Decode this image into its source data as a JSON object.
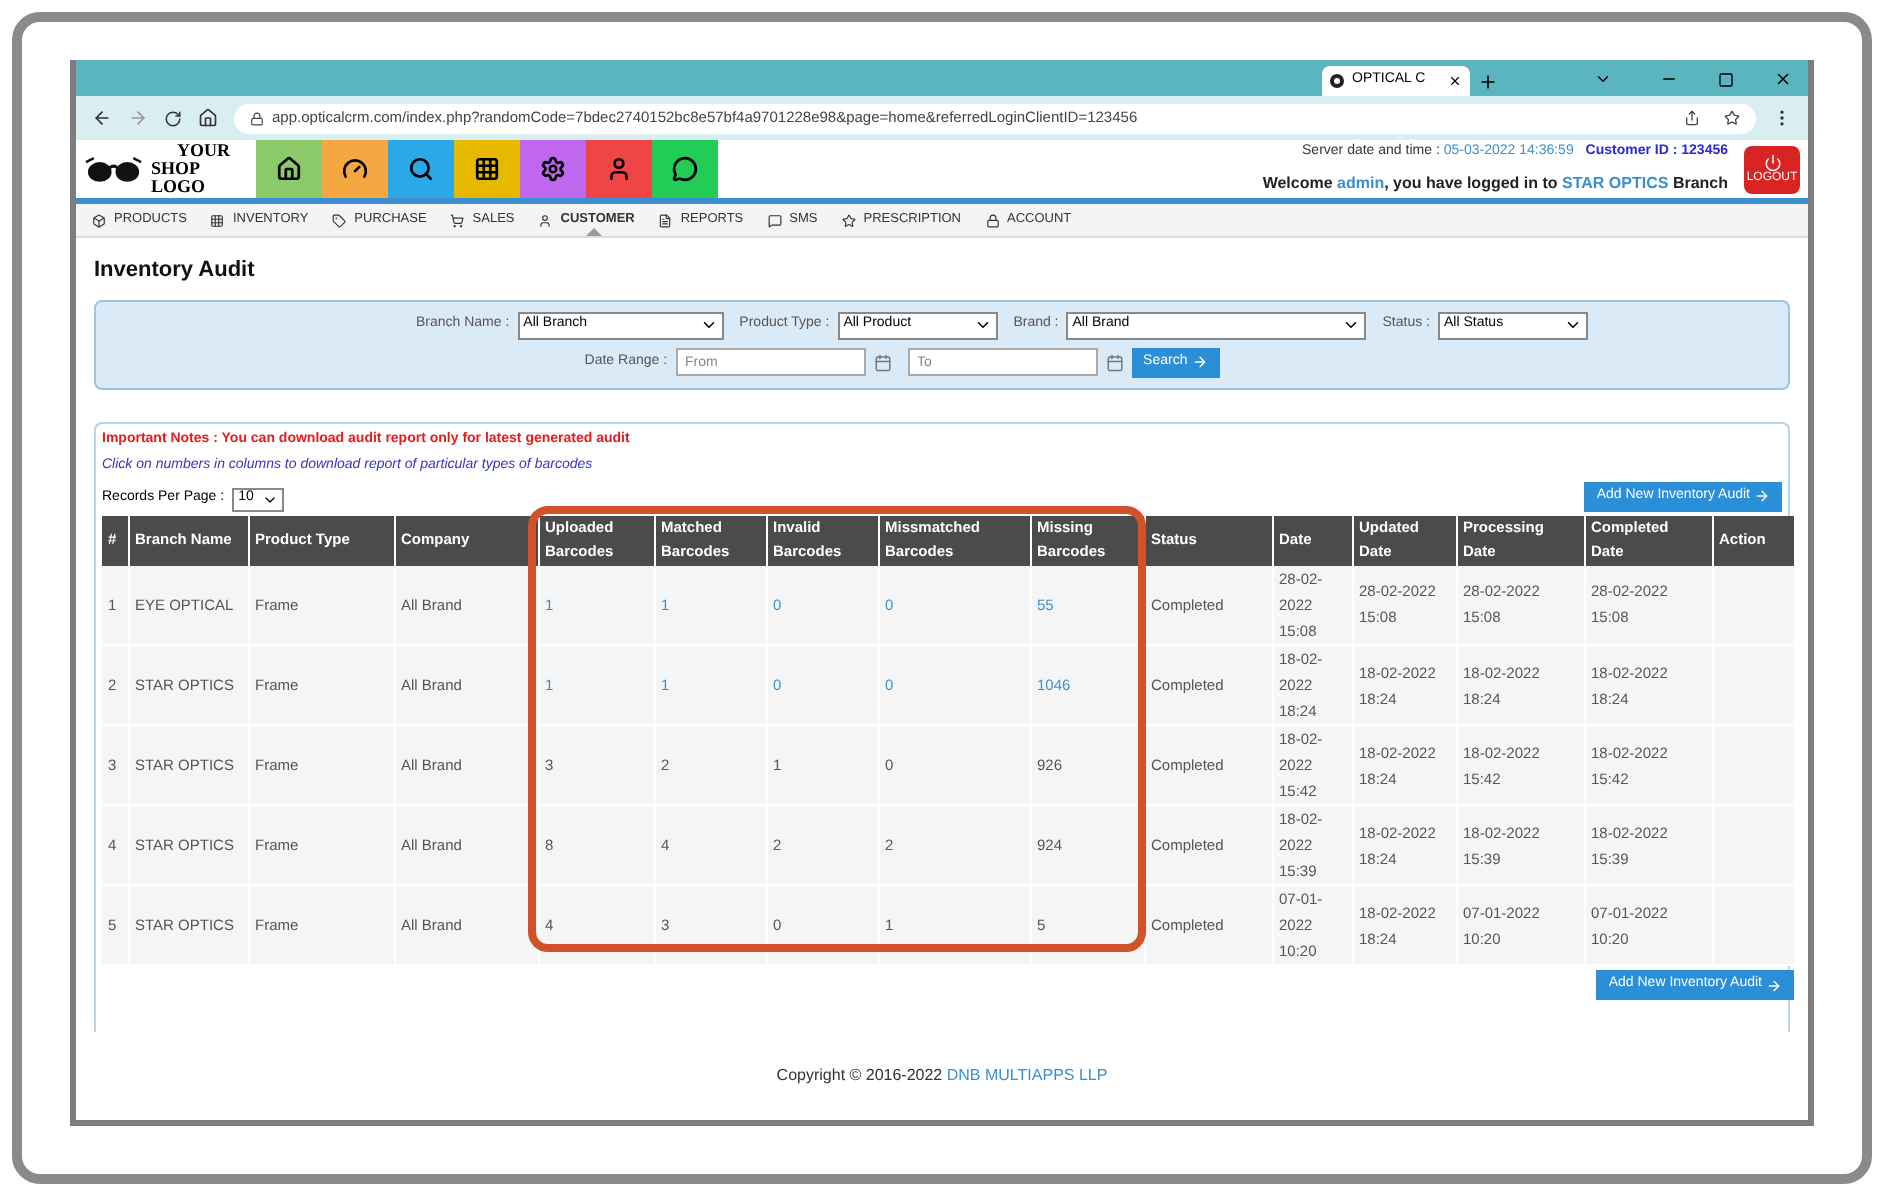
{
  "browser": {
    "tab_title": "OPTICAL C",
    "url": "app.opticalcrm.com/index.php?randomCode=7bdec2740152bc8e57bf4a9701228e98&page=home&referredLoginClientID=123456"
  },
  "header": {
    "logo_lines": [
      "YOUR",
      "SHOP LOGO"
    ],
    "server_label": "Server date and time :",
    "server_time": "05-03-2022 14:36:59",
    "customer_id": "Customer ID : 123456",
    "welcome": "Welcome",
    "user": "admin",
    "logged_text": ", you have logged in to",
    "branch": "STAR OPTICS",
    "branch_suffix": "Branch",
    "logout": "LOGOUT"
  },
  "quick_buttons": [
    {
      "kind": "home",
      "color": "#8cc96b"
    },
    {
      "kind": "gauge",
      "color": "#f5a742"
    },
    {
      "kind": "search",
      "color": "#2aa8e8"
    },
    {
      "kind": "grid",
      "color": "#e6b800"
    },
    {
      "kind": "settings",
      "color": "#c067f0"
    },
    {
      "kind": "user",
      "color": "#f04545"
    },
    {
      "kind": "chat",
      "color": "#22cc55"
    }
  ],
  "nav": [
    {
      "kind": "box",
      "label": "PRODUCTS",
      "selected": false
    },
    {
      "kind": "grid",
      "label": "INVENTORY",
      "selected": false
    },
    {
      "kind": "tag",
      "label": "PURCHASE",
      "selected": false
    },
    {
      "kind": "cart",
      "label": "SALES",
      "selected": false
    },
    {
      "kind": "user",
      "label": "CUSTOMER",
      "selected": true
    },
    {
      "kind": "file",
      "label": "REPORTS",
      "selected": false
    },
    {
      "kind": "chat",
      "label": "SMS",
      "selected": false
    },
    {
      "kind": "star",
      "label": "PRESCRIPTION",
      "selected": false
    },
    {
      "kind": "lock",
      "label": "ACCOUNT",
      "selected": false
    }
  ],
  "page_title": "Inventory Audit",
  "filters": {
    "branch": {
      "label": "Branch Name :",
      "value": "All Branch"
    },
    "product_type": {
      "label": "Product Type :",
      "value": "All Product"
    },
    "brand": {
      "label": "Brand :",
      "value": "All Brand"
    },
    "status": {
      "label": "Status :",
      "value": "All Status"
    },
    "date_range": {
      "label": "Date Range :",
      "from_placeholder": "From",
      "to_placeholder": "To"
    },
    "search_button": "Search"
  },
  "notes": {
    "important": "Important Notes : You can download audit report only for latest generated audit",
    "hint": "Click on numbers in columns to download report of particular types of barcodes"
  },
  "records_per_page": {
    "label": "Records Per Page :",
    "value": "10"
  },
  "add_button": "Add New Inventory Audit",
  "add_button_bottom": "Add New Inventory Audit",
  "table": {
    "columns": [
      "#",
      "Branch Name",
      "Product Type",
      "Company",
      "Uploaded Barcodes",
      "Matched Barcodes",
      "Invalid Barcodes",
      "Missmatched Barcodes",
      "Missing Barcodes",
      "Status",
      "Date",
      "Updated Date",
      "Processing Date",
      "Completed Date",
      "Action"
    ],
    "rows": [
      {
        "cells": [
          "1",
          "EYE OPTICAL",
          "Frame",
          "All Brand",
          "1",
          "1",
          "0",
          "0",
          "55",
          "Completed",
          "28-02-2022 15:08",
          "28-02-2022 15:08",
          "28-02-2022 15:08",
          "28-02-2022 15:08"
        ],
        "linked": true
      },
      {
        "cells": [
          "2",
          "STAR OPTICS",
          "Frame",
          "All Brand",
          "1",
          "1",
          "0",
          "0",
          "1046",
          "Completed",
          "18-02-2022 18:24",
          "18-02-2022 18:24",
          "18-02-2022 18:24",
          "18-02-2022 18:24"
        ],
        "linked": true
      },
      {
        "cells": [
          "3",
          "STAR OPTICS",
          "Frame",
          "All Brand",
          "3",
          "2",
          "1",
          "0",
          "926",
          "Completed",
          "18-02-2022 15:42",
          "18-02-2022 18:24",
          "18-02-2022 15:42",
          "18-02-2022 15:42"
        ],
        "linked": false
      },
      {
        "cells": [
          "4",
          "STAR OPTICS",
          "Frame",
          "All Brand",
          "8",
          "4",
          "2",
          "2",
          "924",
          "Completed",
          "18-02-2022 15:39",
          "18-02-2022 18:24",
          "18-02-2022 15:39",
          "18-02-2022 15:39"
        ],
        "linked": false
      },
      {
        "cells": [
          "5",
          "STAR OPTICS",
          "Frame",
          "All Brand",
          "4",
          "3",
          "0",
          "1",
          "5",
          "Completed",
          "07-01-2022 10:20",
          "18-02-2022 18:24",
          "07-01-2022 10:20",
          "07-01-2022 10:20"
        ],
        "linked": false
      }
    ]
  },
  "footer": {
    "text": "Copyright © 2016-2022",
    "company": "DNB MULTIAPPS LLP"
  }
}
